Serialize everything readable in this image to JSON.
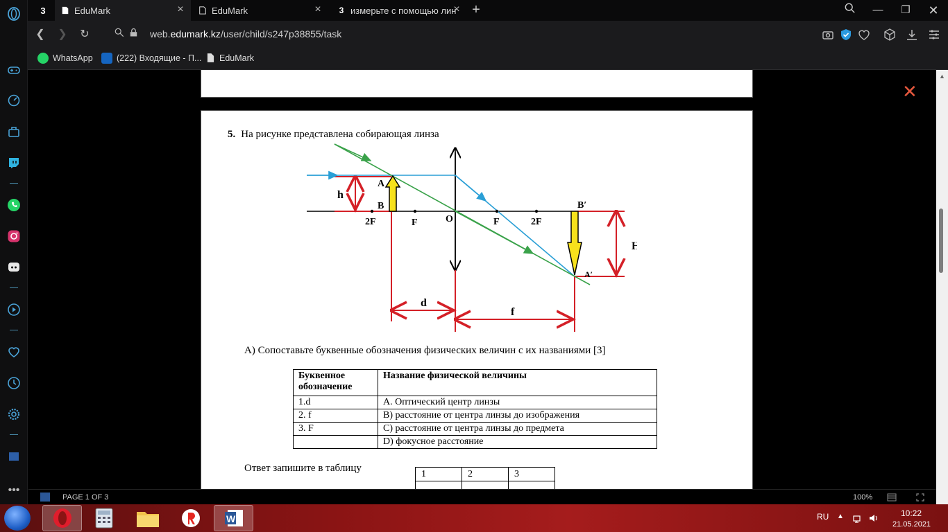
{
  "browser": {
    "pinned_tab_label": "3",
    "tabs": [
      {
        "label": "EduMark",
        "favicon": "doc-icon"
      },
      {
        "label": "EduMark",
        "favicon": "doc-icon"
      },
      {
        "label": "измерьте с помощью лин",
        "favicon": "3"
      }
    ],
    "url_prefix": "web.",
    "url_domain": "edumark.kz",
    "url_path": "/user/child/s247p38855/task"
  },
  "bookmarks": [
    {
      "label": "WhatsApp",
      "color": "#25d366"
    },
    {
      "label": "(222) Входящие - П...",
      "color": "#1565c0"
    },
    {
      "label": "EduMark",
      "color": "#dddddd"
    }
  ],
  "question": {
    "number": "5.",
    "text": "На рисунке представлена собирающая линза",
    "figure_labels": {
      "A": "A",
      "B": "B",
      "h": "h",
      "2F_left": "2F",
      "F_left": "F",
      "O": "O",
      "F_right": "F",
      "2F_right": "2F",
      "B_prime": "B′",
      "A_prime": "A′",
      "H": "H",
      "d": "d",
      "f": "f"
    },
    "part_a": "А) Сопоставьте буквенные обозначения физических величин с их названиями [3]",
    "table_header": [
      "Буквенное обозначение",
      "Название физической  величины"
    ],
    "table_rows": [
      [
        "1.d",
        "А. Оптический центр линзы"
      ],
      [
        "2. f",
        "B) расстояние от центра линзы до изображения"
      ],
      [
        "3. F",
        "C) расстояние от центра линзы до предмета"
      ],
      [
        "",
        "D) фокусное расстояние"
      ]
    ],
    "answer_label": "Ответ запишите в таблицу",
    "answer_cols": [
      "1",
      "2",
      "3"
    ]
  },
  "statusbar": {
    "page": "PAGE 1 OF 3",
    "zoom": "100%"
  },
  "tray": {
    "lang": "RU",
    "time": "10:22",
    "date": "21.05.2021"
  }
}
